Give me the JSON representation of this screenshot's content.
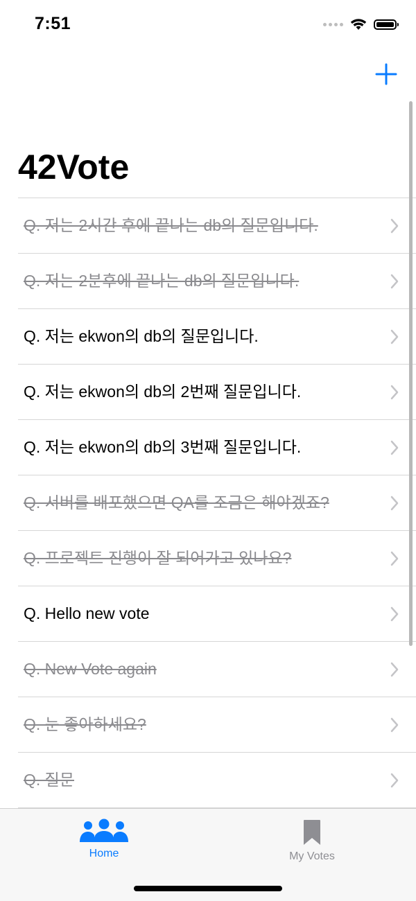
{
  "status": {
    "time": "7:51"
  },
  "nav": {
    "title": "42Vote"
  },
  "votes": [
    {
      "text": "Q. 저는 2시간 후에 끝나는 db의 질문입니다."
    },
    {
      "text": "Q. 저는 2분후에 끝나는 db의 질문입니다."
    },
    {
      "text": "Q. 저는 ekwon의 db의 질문입니다."
    },
    {
      "text": "Q. 저는 ekwon의 db의 2번째 질문입니다."
    },
    {
      "text": "Q. 저는 ekwon의 db의 3번째 질문입니다."
    },
    {
      "text": "Q. 서버를 배포했으면 QA를 조금은 해야겠죠?"
    },
    {
      "text": "Q. 프로젝트 진행이 잘 되어가고 있나요?"
    },
    {
      "text": "Q. Hello new vote"
    },
    {
      "text": "Q. New Vote again"
    },
    {
      "text": "Q. 눈 좋아하세요?"
    },
    {
      "text": "Q. 질문"
    }
  ],
  "tabs": [
    {
      "label": "Home",
      "icon": "people-icon"
    },
    {
      "label": "My Votes",
      "icon": "bookmark-icon"
    }
  ],
  "colors": {
    "accent": "#0a7cff",
    "inactive": "#8e8e93",
    "ended_text": "#8a8a8e"
  }
}
